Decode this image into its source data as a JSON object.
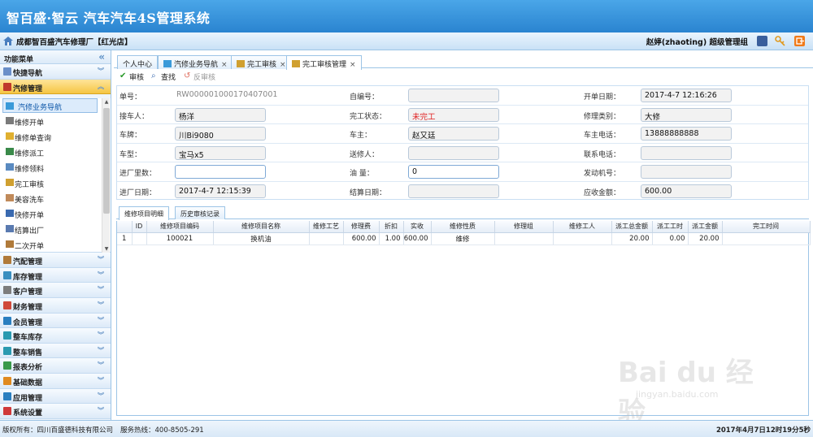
{
  "app": {
    "title": "智百盛·智云 汽车汽车4S管理系统"
  },
  "storebar": {
    "store": "成都智百盛汽车修理厂【红光店】",
    "user": "赵婷(zhaoting) 超级管理组"
  },
  "nav": {
    "header": "功能菜单",
    "groups_top": [
      {
        "label": "快捷导航",
        "icon": "star-icon",
        "color": "#6a8fc9"
      },
      {
        "label": "汽修管理",
        "icon": "wrench-icon",
        "color": "#c0392b",
        "active": true
      }
    ],
    "sub_items": [
      {
        "label": "汽修业务导航",
        "icon": "car-icon"
      },
      {
        "label": "维修开单",
        "icon": "tools-icon"
      },
      {
        "label": "维修单查询",
        "icon": "search-doc-icon"
      },
      {
        "label": "维修派工",
        "icon": "dispatch-icon"
      },
      {
        "label": "维修领料",
        "icon": "material-icon"
      },
      {
        "label": "完工审核",
        "icon": "audit-icon"
      },
      {
        "label": "美容洗车",
        "icon": "wash-icon"
      },
      {
        "label": "快修开单",
        "icon": "quick-icon"
      },
      {
        "label": "结算出厂",
        "icon": "settle-icon"
      },
      {
        "label": "二次开单",
        "icon": "reopen-icon"
      }
    ],
    "groups_bottom": [
      {
        "label": "汽配管理",
        "icon": "parts-icon",
        "color": "#b07a3a"
      },
      {
        "label": "库存管理",
        "icon": "stock-icon",
        "color": "#3a8fc0"
      },
      {
        "label": "客户管理",
        "icon": "customer-icon",
        "color": "#7d7d7d"
      },
      {
        "label": "财务管理",
        "icon": "finance-icon",
        "color": "#d04a3a"
      },
      {
        "label": "会员管理",
        "icon": "member-icon",
        "color": "#2a7fc0"
      },
      {
        "label": "整车库存",
        "icon": "vehicle-stock-icon",
        "color": "#2a9ab0"
      },
      {
        "label": "整车销售",
        "icon": "vehicle-sales-icon",
        "color": "#2a9ab0"
      },
      {
        "label": "报表分析",
        "icon": "report-icon",
        "color": "#3a9a4a"
      },
      {
        "label": "基础数据",
        "icon": "data-icon",
        "color": "#e08a20"
      },
      {
        "label": "应用管理",
        "icon": "app-icon",
        "color": "#2a7fc0"
      },
      {
        "label": "系统设置",
        "icon": "settings-icon",
        "color": "#d03a3a"
      }
    ]
  },
  "tabs": [
    {
      "label": "个人中心",
      "closable": false
    },
    {
      "label": "汽修业务导航",
      "closable": true
    },
    {
      "label": "完工审核",
      "closable": true
    },
    {
      "label": "完工审核管理",
      "closable": true,
      "active": true
    }
  ],
  "toolbar": {
    "audit": "审核",
    "find": "查找",
    "unaudit": "反审核"
  },
  "form": {
    "order_no_label": "单号：",
    "order_no": "RW000001000170407001",
    "self_no_label": "自编号：",
    "self_no": "",
    "open_date_label": "开单日期：",
    "open_date": "2017-4-7 12:16:26",
    "receiver_label": "接车人：",
    "receiver": "杨洋",
    "status_label": "完工状态：",
    "status": "未完工",
    "repair_type_label": "修理类别：",
    "repair_type": "大修",
    "plate_label": "车牌：",
    "plate": "川Bi9080",
    "owner_label": "车主：",
    "owner": "赵又廷",
    "owner_phone_label": "车主电话：",
    "owner_phone": "13888888888",
    "model_label": "车型：",
    "model": "宝马x5",
    "sender_label": "送修人：",
    "sender": "",
    "contact_label": "联系电话：",
    "contact": "",
    "mileage_label": "进厂里数：",
    "mileage": "",
    "fuel_label": "油 量：",
    "fuel": "0",
    "engine_label": "发动机号：",
    "engine": "",
    "in_date_label": "进厂日期：",
    "in_date": "2017-4-7 12:15:39",
    "settle_date_label": "结算日期：",
    "settle_date": "",
    "receivable_label": "应收金额：",
    "receivable": "600.00"
  },
  "detail_tabs": {
    "items": "维修项目明细",
    "history": "历史审核记录"
  },
  "grid": {
    "headers": [
      "",
      "ID",
      "维修项目编码",
      "维修项目名称",
      "维修工艺",
      "修理费",
      "折扣",
      "实收",
      "维修性质",
      "修理组",
      "维修工人",
      "派工总金额",
      "派工工时",
      "派工金额",
      "完工时间"
    ],
    "rows": [
      [
        "1",
        "",
        "100021",
        "换机油",
        "",
        "600.00",
        "1.00",
        "600.00",
        "维修",
        "",
        "",
        "20.00",
        "0.00",
        "20.00",
        ""
      ]
    ]
  },
  "watermark": {
    "big": "Bai du 经验",
    "small": "jingyan.baidu.com"
  },
  "footer": {
    "copyright": "版权所有：四川百盛德科技有限公司",
    "hotline": "服务热线：400-8505-291",
    "datetime": "2017年4月7日12时19分5秒"
  }
}
